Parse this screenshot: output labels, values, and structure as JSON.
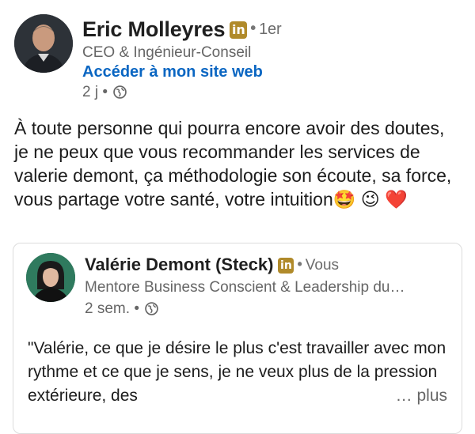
{
  "post": {
    "author": {
      "name": "Eric Molleyres",
      "badge": "in",
      "degree": "1er",
      "headline": "CEO & Ingénieur-Conseil",
      "website_link": "Accéder à mon site web",
      "time": "2 j",
      "visibility_icon": "globe-icon"
    },
    "body": {
      "text": "À toute personne qui pourra encore avoir des doutes, je ne peux que vous recommander les services de valerie demont, ça méthodologie son écoute, sa force, vous partage votre santé, votre intuition",
      "emojis": [
        "🤩",
        "😉",
        "❤️"
      ]
    }
  },
  "shared_post": {
    "author": {
      "name": "Valérie Demont (Steck)",
      "badge": "in",
      "degree": "Vous",
      "headline": "Mentore Business Conscient & Leadership du…",
      "time": "2 sem.",
      "visibility_icon": "globe-icon"
    },
    "text": "\"Valérie, ce que je désire le plus c'est travailler avec mon rythme et ce que je sens, je ne veux plus de la pression extérieure, des",
    "see_more": "… plus"
  },
  "colors": {
    "link": "#0a66c2",
    "secondary_text": "#666666",
    "badge": "#b08a2a"
  }
}
